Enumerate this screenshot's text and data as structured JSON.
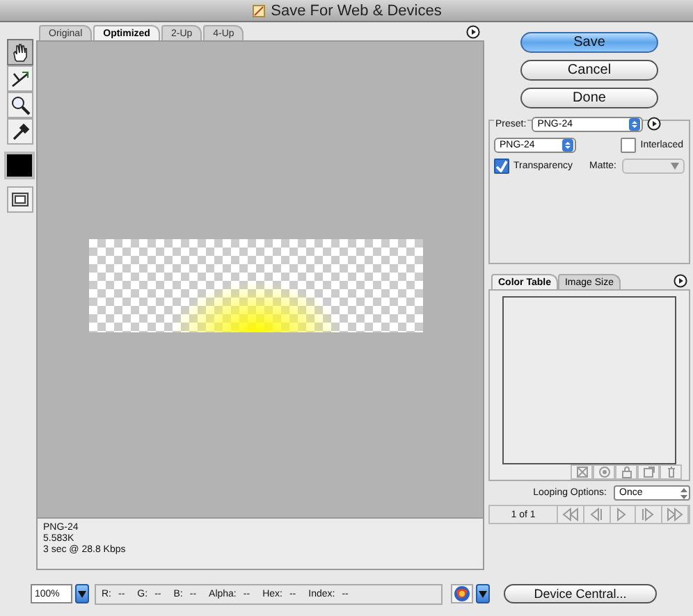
{
  "window": {
    "title": "Save For Web & Devices"
  },
  "tools": [
    {
      "kind": "hand",
      "selected": true
    },
    {
      "kind": "slice",
      "selected": false
    },
    {
      "kind": "zoom",
      "selected": false
    },
    {
      "kind": "eyedropper",
      "selected": false
    }
  ],
  "view_tabs": [
    {
      "label": "Original",
      "selected": false
    },
    {
      "label": "Optimized",
      "selected": true
    },
    {
      "label": "2-Up",
      "selected": false
    },
    {
      "label": "4-Up",
      "selected": false
    }
  ],
  "image_info": [
    "PNG-24",
    "5.583K",
    "3 sec @ 28.8 Kbps"
  ],
  "buttons": [
    {
      "label": "Save",
      "default": true
    },
    {
      "label": "Cancel",
      "default": false
    },
    {
      "label": "Done",
      "default": false
    }
  ],
  "settings": {
    "preset_label": "Preset:",
    "preset": "PNG-24",
    "format": "PNG-24",
    "interlaced": {
      "label": "Interlaced",
      "checked": false
    },
    "transparency": {
      "label": "Transparency",
      "checked": true
    },
    "matte": {
      "label": "Matte:",
      "disabled": true
    }
  },
  "panel_tabs": [
    {
      "label": "Color Table",
      "selected": true
    },
    {
      "label": "Image Size",
      "selected": false
    }
  ],
  "looping": {
    "label": "Looping Options:",
    "value": "Once"
  },
  "frame_counter": "1 of 1",
  "zoom": "100%",
  "readouts": [
    {
      "label": "R:",
      "value": "--"
    },
    {
      "label": "G:",
      "value": "--"
    },
    {
      "label": "B:",
      "value": "--"
    },
    {
      "label": "Alpha:",
      "value": "--"
    },
    {
      "label": "Hex:",
      "value": "--"
    },
    {
      "label": "Index:",
      "value": "--"
    }
  ],
  "device_central": "Device Central..."
}
